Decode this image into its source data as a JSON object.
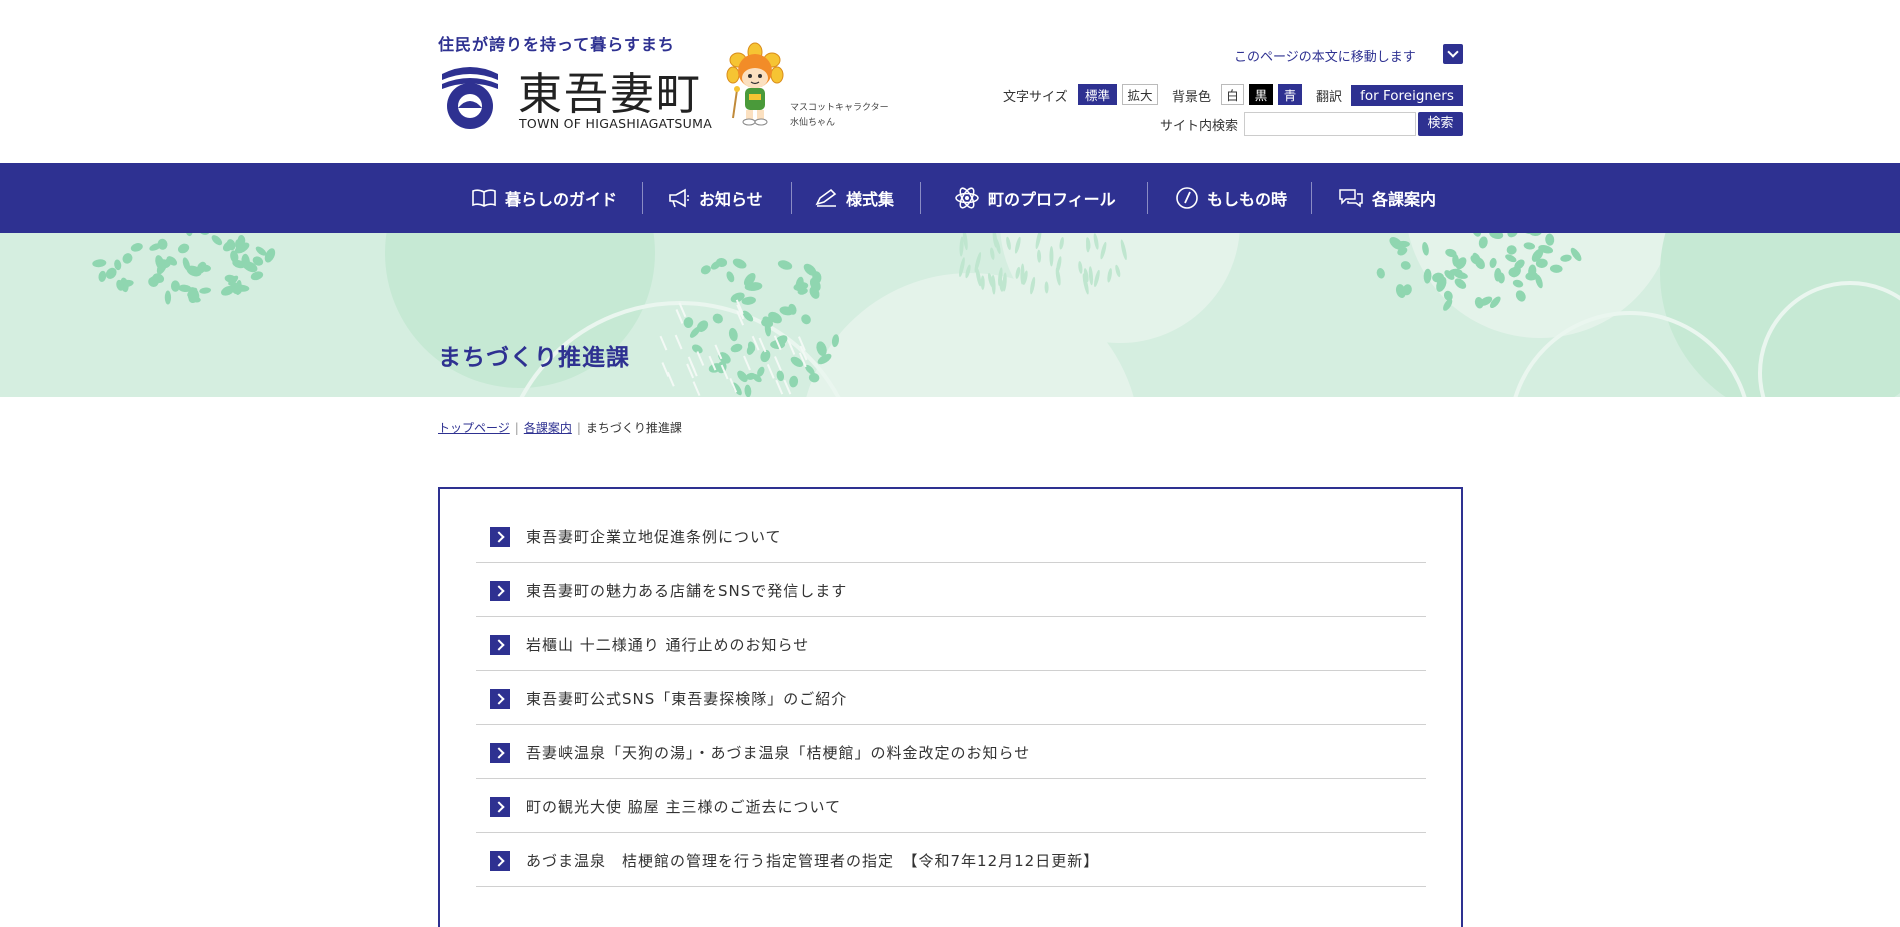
{
  "header": {
    "slogan": "住民が誇りを持って暮らすまち",
    "logo_jp": "東吾妻町",
    "logo_en": "TOWN OF HIGASHIAGATSUMA",
    "mascot_label_1": "マスコットキャラクター",
    "mascot_label_2": "水仙ちゃん",
    "skip_link": "このページの本文に移動します",
    "font_size_label": "文字サイズ",
    "font_std": "標準",
    "font_large": "拡大",
    "bg_color_label": "背景色",
    "bg_white": "白",
    "bg_black": "黒",
    "bg_blue": "青",
    "translate_label": "翻訳",
    "for_foreigners": "for Foreigners",
    "search_label": "サイト内検索",
    "search_placeholder": "",
    "search_button": "検索"
  },
  "nav": [
    {
      "label": "暮らしのガイド",
      "icon": "book-icon"
    },
    {
      "label": "お知らせ",
      "icon": "megaphone-icon"
    },
    {
      "label": "様式集",
      "icon": "pen-icon"
    },
    {
      "label": "町のプロフィール",
      "icon": "atom-icon"
    },
    {
      "label": "もしもの時",
      "icon": "compass-icon"
    },
    {
      "label": "各課案内",
      "icon": "chat-icon"
    }
  ],
  "page_title": "まちづくり推進課",
  "breadcrumb": {
    "home": "トップページ",
    "departments": "各課案内",
    "current": "まちづくり推進課",
    "separator": "|"
  },
  "list": [
    "東吾妻町企業立地促進条例について",
    "東吾妻町の魅力ある店舗をSNSで発信します",
    "岩櫃山 十二様通り 通行止めのお知らせ",
    "東吾妻町公式SNS「東吾妻探検隊」のご紹介",
    "吾妻峡温泉「天狗の湯」・あづま温泉「桔梗館」の料金改定のお知らせ",
    "町の観光大使 脇屋 主三様のご逝去について",
    "あづま温泉　桔梗館の管理を行う指定管理者の指定　【令和7年12月12日更新】"
  ],
  "colors": {
    "brand": "#2e3191",
    "hero_bg": "#d5eee0",
    "hero_dots": "#8fd6b0"
  }
}
